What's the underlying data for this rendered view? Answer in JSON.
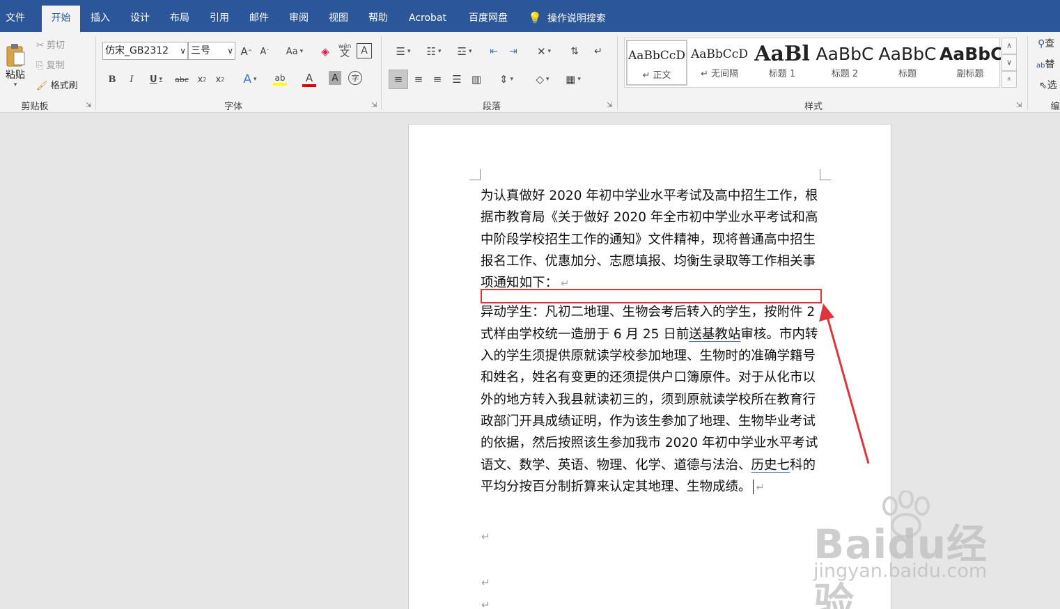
{
  "tabs": [
    {
      "label": "文件"
    },
    {
      "label": "开始"
    },
    {
      "label": "插入"
    },
    {
      "label": "设计"
    },
    {
      "label": "布局"
    },
    {
      "label": "引用"
    },
    {
      "label": "邮件"
    },
    {
      "label": "审阅"
    },
    {
      "label": "视图"
    },
    {
      "label": "帮助"
    },
    {
      "label": "Acrobat"
    },
    {
      "label": "百度网盘"
    },
    {
      "label": "操作说明搜索"
    }
  ],
  "clipboard": {
    "paste": "粘贴",
    "cut": "剪切",
    "copy": "复制",
    "format_painter": "格式刷",
    "label": "剪贴板"
  },
  "font": {
    "family": "仿宋_GB2312",
    "size": "三号",
    "label": "字体",
    "case_btn": "Aa",
    "phonetic": "wén"
  },
  "paragraph": {
    "label": "段落"
  },
  "styles": {
    "label": "样式",
    "items": [
      {
        "sample": "AaBbCcD",
        "name": "↵ 正文"
      },
      {
        "sample": "AaBbCcD",
        "name": "↵ 无间隔"
      },
      {
        "sample": "AaBl",
        "name": "标题 1"
      },
      {
        "sample": "AaBbC",
        "name": "标题 2"
      },
      {
        "sample": "AaBbC",
        "name": "标题"
      },
      {
        "sample": "AaBbC",
        "name": "副标题"
      }
    ]
  },
  "editing": {
    "label": "编",
    "find": "查",
    "replace": "替",
    "select": "选"
  },
  "document": {
    "para1": "为认真做好 2020 年初中学业水平考试及高中招生工作，根据市教育局《关于做好 2020 年全市初中学业水平考试和高中阶段学校招生工作的通知》文件精神，现将普通高中招生报名工作、优惠加分、志愿填报、均衡生录取等工作相关事项通知如下：",
    "para2_part1": "异动学生：凡初二地理、生物会考后转入的学生，按附件 2 式样由学校统一造册于 6 月 25 日前",
    "para2_link1": "送基教站",
    "para2_part2": "审核。市内转入的学生须提供原就读学校参加地理、生物时的准确学籍号和姓名，姓名有变更的还须提供户口簿原件。对于从化市以外的地方转入我县就读初三的，须到原就读学校所在教育行政部门开具成绩证明，作为该生参加了地理、生物毕业考试的依据，然后按照该生参加我市 2020 年初中学业水平考试语文、数学、英语、物理、化学、道德与法治、",
    "para2_link2": "历史七",
    "para2_part3": "科的平均分按百分制折算来认定其地理、生物成绩。",
    "para_mark": "↵"
  },
  "watermark": {
    "main": "Baidu经验",
    "sub": "jingyan.baidu.com"
  },
  "colors": {
    "title_bar": "#2b579a",
    "ribbon": "#f3f3f3",
    "annotation": "#e0343a"
  }
}
